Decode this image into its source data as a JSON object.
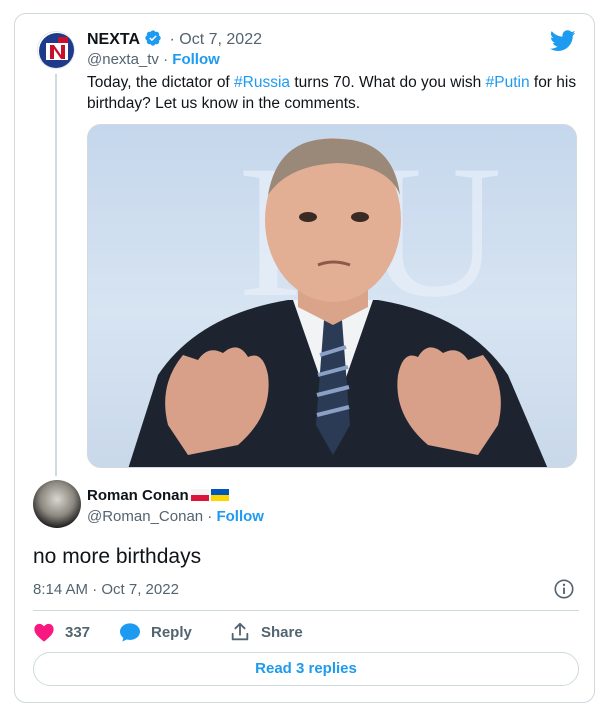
{
  "parent_tweet": {
    "author_name": "NEXTA",
    "date": "Oct 7, 2022",
    "handle": "@nexta_tv",
    "follow_label": "Follow",
    "text_parts": [
      {
        "text": "Today, the dictator of ",
        "hashtag": false
      },
      {
        "text": "#Russia",
        "hashtag": true
      },
      {
        "text": " turns 70. What do you wish ",
        "hashtag": false
      },
      {
        "text": "#Putin",
        "hashtag": true
      },
      {
        "text": " for his birthday? Let us know in the comments.",
        "hashtag": false
      }
    ],
    "media_icon": "photo-of-man-gesturing"
  },
  "reply_tweet": {
    "author_name": "Roman Conan",
    "flags": [
      "poland-flag-icon",
      "ukraine-flag-icon"
    ],
    "handle": "@Roman_Conan",
    "follow_label": "Follow",
    "text": "no more birthdays",
    "timestamp": "8:14 AM · Oct 7, 2022"
  },
  "actions": {
    "like_count": "337",
    "reply_label": "Reply",
    "share_label": "Share"
  },
  "read_replies_label": "Read 3 replies",
  "colors": {
    "accent": "#1d9bf0",
    "like": "#f91880",
    "text": "#0f1419",
    "muted": "#536471",
    "border": "#cfd9de"
  }
}
